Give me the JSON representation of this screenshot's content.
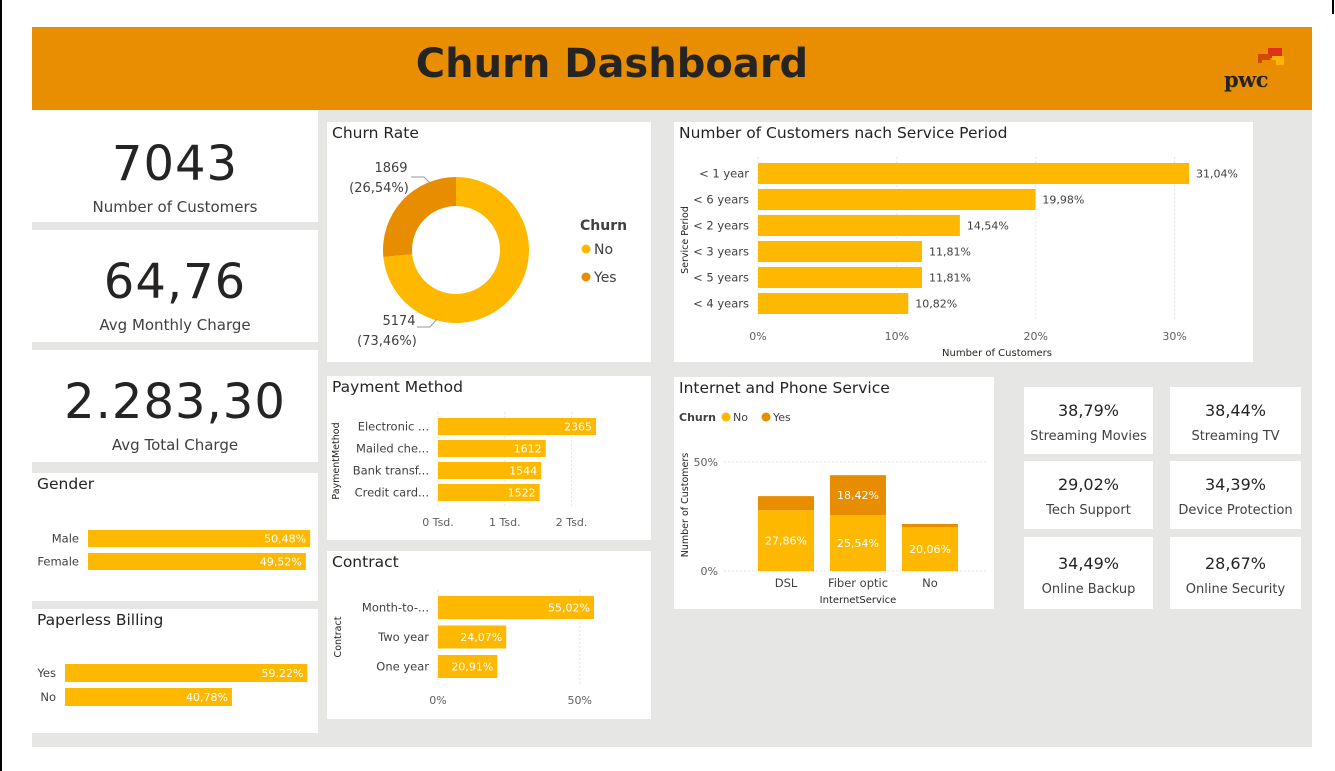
{
  "header": {
    "title": "Churn Dashboard",
    "logo_text": "pwc"
  },
  "colors": {
    "header_bg": "#e88e00",
    "no": "#ffb800",
    "yes": "#e88d00",
    "canvas": "#e6e6e5"
  },
  "kpis": [
    {
      "value": "7043",
      "label": "Number of Customers"
    },
    {
      "value": "64,76",
      "label": "Avg Monthly Charge"
    },
    {
      "value": "2.283,30",
      "label": "Avg Total Charge"
    }
  ],
  "service_kpis": [
    {
      "value": "38,79%",
      "label": "Streaming Movies"
    },
    {
      "value": "38,44%",
      "label": "Streaming TV"
    },
    {
      "value": "29,02%",
      "label": "Tech Support"
    },
    {
      "value": "34,39%",
      "label": "Device Protection"
    },
    {
      "value": "34,49%",
      "label": "Online Backup"
    },
    {
      "value": "28,67%",
      "label": "Online Security"
    }
  ],
  "chart_data": [
    {
      "id": "churn-rate",
      "type": "pie",
      "title": "Churn Rate",
      "legend_title": "Churn",
      "legend_position": "right",
      "slices": [
        {
          "name": "No",
          "value": 5174,
          "label": "5174",
          "pct_label": "(73,46%)"
        },
        {
          "name": "Yes",
          "value": 1869,
          "label": "1869",
          "pct_label": "(26,54%)"
        }
      ]
    },
    {
      "id": "gender",
      "type": "bar",
      "orientation": "horizontal",
      "title": "Gender",
      "categories": [
        "Male",
        "Female"
      ],
      "values": [
        50.48
      ],
      "labels": [
        "50,48%",
        "49,52%"
      ],
      "all_values": [
        50.48,
        49.52
      ],
      "xlim": [
        0,
        60
      ]
    },
    {
      "id": "paperless",
      "type": "bar",
      "orientation": "horizontal",
      "title": "Paperless Billing",
      "categories": [
        "Yes",
        "No"
      ],
      "values": [
        59.22,
        40.78
      ],
      "labels": [
        "59,22%",
        "40,78%"
      ],
      "xlim": [
        0,
        64
      ]
    },
    {
      "id": "service-period",
      "type": "bar",
      "orientation": "horizontal",
      "title": "Number of Customers nach Service Period",
      "xlabel": "Number of Customers",
      "ylabel": "Service Period",
      "categories": [
        "< 1 year",
        "< 6 years",
        "< 2 years",
        "< 3 years",
        "< 5 years",
        "< 4 years"
      ],
      "values": [
        31.04,
        19.98,
        14.54,
        11.81,
        11.81,
        10.82
      ],
      "labels": [
        "31,04%",
        "19,98%",
        "14,54%",
        "11,81%",
        "11,81%",
        "10,82%"
      ],
      "xticks": [
        0,
        10,
        20,
        30
      ],
      "xtick_labels": [
        "0%",
        "10%",
        "20%",
        "30%"
      ],
      "xlim": [
        0,
        31.04
      ],
      "grid": true
    },
    {
      "id": "payment-method",
      "type": "bar",
      "orientation": "horizontal",
      "title": "Payment Method",
      "ylabel": "PaymentMethod",
      "categories": [
        "Electronic ...",
        "Mailed che...",
        "Bank transf...",
        "Credit card..."
      ],
      "values": [
        2365,
        1612,
        1544,
        1522
      ],
      "labels": [
        "2365",
        "1612",
        "1544",
        "1522"
      ],
      "xticks": [
        0,
        1000,
        2000
      ],
      "xtick_labels": [
        "0 Tsd.",
        "1 Tsd.",
        "2 Tsd."
      ],
      "xlim": [
        0,
        2365
      ],
      "grid": true
    },
    {
      "id": "contract",
      "type": "bar",
      "orientation": "horizontal",
      "title": "Contract",
      "ylabel": "Contract",
      "categories": [
        "Month-to-...",
        "Two year",
        "One year"
      ],
      "values": [
        55.02,
        24.07,
        20.91
      ],
      "labels": [
        "55,02%",
        "24,07%",
        "20,91%"
      ],
      "xticks": [
        0,
        50
      ],
      "xtick_labels": [
        "0%",
        "50%"
      ],
      "xlim": [
        0,
        55.02
      ],
      "grid": true
    },
    {
      "id": "internet-phone",
      "type": "bar",
      "stacked": true,
      "title": "Internet and Phone Service",
      "legend_title": "Churn",
      "legend_position": "top-left",
      "xlabel": "InternetService",
      "ylabel": "Number of Customers",
      "categories": [
        "DSL",
        "Fiber optic",
        "No"
      ],
      "series": [
        {
          "name": "No",
          "values": [
            27.86,
            25.54,
            20.06
          ],
          "labels": [
            "27,86%",
            "25,54%",
            "20,06%"
          ]
        },
        {
          "name": "Yes",
          "values": [
            6.5,
            18.42,
            1.5
          ],
          "labels": [
            "",
            "18,42%",
            ""
          ]
        }
      ],
      "yticks": [
        0,
        50
      ],
      "ytick_labels": [
        "0%",
        "50%"
      ],
      "ylim": [
        0,
        50
      ],
      "grid": true
    }
  ]
}
